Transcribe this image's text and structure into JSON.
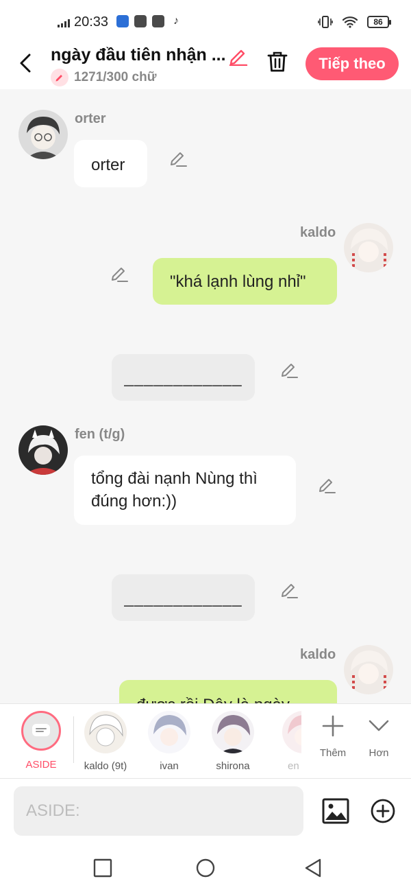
{
  "status": {
    "time": "20:33",
    "battery": "86"
  },
  "header": {
    "title": "ngày đầu tiên nhận ...",
    "word_count": "1271/300 chữ",
    "next_label": "Tiếp theo"
  },
  "messages": [
    {
      "speaker": "orter",
      "side": "left",
      "text": "orter"
    },
    {
      "speaker": "kaldo",
      "side": "right",
      "text": "\"khá lạnh lùng nhỉ\""
    },
    {
      "side": "aside",
      "text": "____________"
    },
    {
      "speaker": "fen (t/g)",
      "side": "left",
      "text_lines": [
        "tổng đài nạnh Nùng thì",
        "đúng hơn:))"
      ]
    },
    {
      "side": "aside",
      "text": "____________"
    },
    {
      "speaker": "kaldo",
      "side": "right",
      "text": "được rồi Đây là ngày..."
    }
  ],
  "characters": [
    {
      "label": "ASIDE",
      "selected": true
    },
    {
      "label": "kaldo (9t)"
    },
    {
      "label": "ivan"
    },
    {
      "label": "shirona"
    },
    {
      "label": "en"
    }
  ],
  "tools": {
    "add_label": "Thêm",
    "more_label": "Hơn"
  },
  "input": {
    "placeholder": "ASIDE:"
  },
  "colors": {
    "accent": "#ff5a74",
    "right_bubble": "#d6f293",
    "left_bubble": "#ffffff",
    "aside_bubble": "#ececec"
  }
}
